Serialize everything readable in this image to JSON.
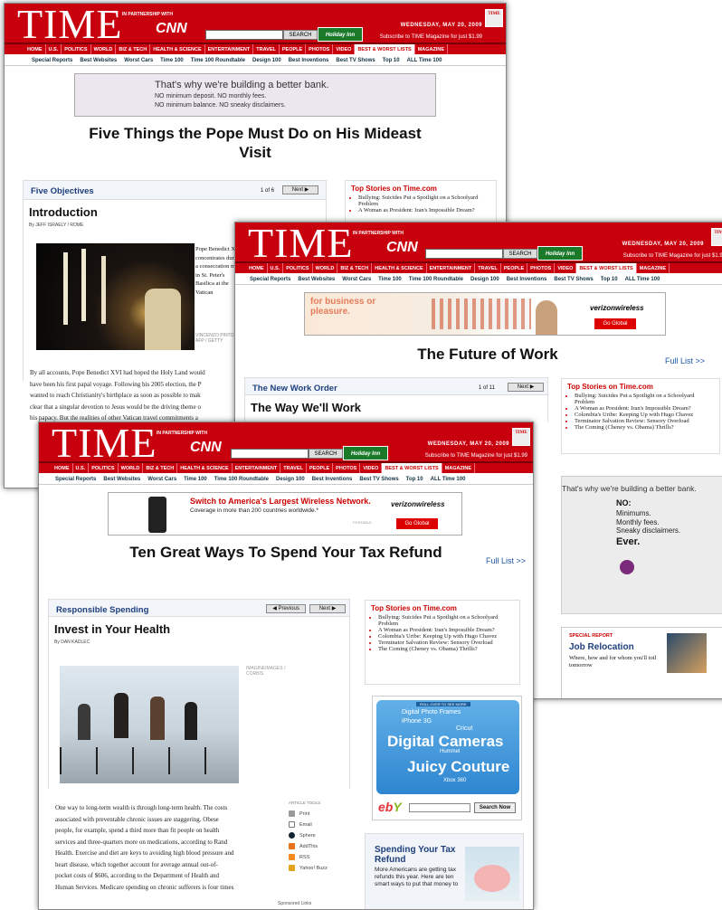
{
  "shared": {
    "logo": "TIME",
    "partnership": "IN PARTNERSHIP WITH",
    "cnn": "CNN",
    "search_button": "SEARCH",
    "holiday_inn": "Holiday Inn",
    "date": "WEDNESDAY, MAY 20, 2009",
    "subscribe": "Subscribe to TIME Magazine for just $1.99",
    "cover": "TIME",
    "nav": [
      "HOME",
      "U.S.",
      "POLITICS",
      "WORLD",
      "BIZ & TECH",
      "HEALTH & SCIENCE",
      "ENTERTAINMENT",
      "TRAVEL",
      "PEOPLE",
      "PHOTOS",
      "VIDEO",
      "BEST & WORST LISTS",
      "MAGAZINE"
    ],
    "subnav": [
      "Special Reports",
      "Best Websites",
      "Worst Cars",
      "Time 100",
      "Time 100 Roundtable",
      "Design 100",
      "Best Inventions",
      "Best TV Shows",
      "Top 10",
      "ALL Time 100"
    ],
    "next": "Next ▶",
    "previous": "◀ Previous",
    "full_list": "Full List >>",
    "top_stories_title": "Top Stories on Time.com",
    "top_stories": [
      "Bullying: Suicides Put a Spotlight on a Schoolyard Problem",
      "A Woman as President: Iran's Impossible Dream?",
      "Colombia's Uribe: Keeping Up with Hugo Chavez",
      "Terminator Salvation Review: Sensory Overload",
      "The Coming (Cheney vs. Obama) Thrills?"
    ]
  },
  "w1": {
    "ad_line1": "That's why we're building a better bank.",
    "ad_line2": "NO minimum deposit.   NO monthly fees.",
    "ad_line3": "NO minimum balance.   NO sneaky disclaimers.",
    "headline": "Five Things the Pope Must Do on His Mideast Visit",
    "section": "Five Objectives",
    "page": "1 of 6",
    "title": "Introduction",
    "byline": "By JEFF ISRAELY / ROME",
    "caption": "Pope Benedict XVI concentrates during a consecration mass in St. Peter's Basilica at the Vatican",
    "credit": "VINCENZO PINTO / AFP / GETTY",
    "body": [
      "By all accounts, Pope Benedict XVI had hoped the Holy Land would",
      "have been his first papal voyage. Following his 2005 election, the P",
      "wanted to reach Christianity's birthplace as soon as possible to mak",
      "clear that a singular devotion to Jesus would be the driving theme o",
      "his papacy. But the realities of other Vatican travel commitments a"
    ]
  },
  "w2": {
    "ad_text": "for business or pleasure.",
    "verizon": "verizonwireless",
    "go_global": "Go Global",
    "headline": "The Future of Work",
    "section": "The New Work Order",
    "page": "1 of 11",
    "title": "The Way We'll Work",
    "bank_line1": "That's why we're building a better bank.",
    "bank_no": "NO:",
    "bank_items": [
      "Minimums.",
      "Monthly fees.",
      "Sneaky disclaimers."
    ],
    "bank_ever": "Ever.",
    "special_label": "SPECIAL REPORT",
    "special_title": "Job Relocation",
    "special_desc": "Where, how and for whom you'll toil tomorrow"
  },
  "w3": {
    "ad_title": "Switch to America's Largest Wireless Network.",
    "ad_sub": "Coverage in more than 200 countries worldwide.*",
    "ad_postal": "POSTABLE",
    "verizon": "verizonwireless",
    "go_global": "Go Global",
    "headline": "Ten Great Ways To Spend Your Tax Refund",
    "section": "Responsible Spending",
    "title": "Invest in Your Health",
    "byline": "By DAN KADLEC",
    "credit": "IMAGINEIMAGES / CORBIS",
    "body": [
      "One way to long-term wealth is through long-term health. The costs",
      "associated with preventable chronic issues are staggering. Obese",
      "people, for example, spend a third more than fit people on health",
      "services and three-quarters more on medications, according to Rand",
      "Health. Exercise and diet are keys to avoiding high blood pressure and",
      "heart disease, which together account for average annual out-of-",
      "pocket costs of $606, according to the Department of Health and",
      "Human Services. Medicare spending on chronic sufferers is four times"
    ],
    "tools_title": "ARTICLE TOOLS",
    "tools": [
      "Print",
      "Email",
      "Sphere",
      "AddThis",
      "RSS",
      "Yahoo! Buzz"
    ],
    "sponsored": "Sponsored Links",
    "ebay_roll": "ROLL OVER TO SEE MORE",
    "ebay_items": [
      "Digital Photo Frames",
      "iPhone 3G",
      "Cricut"
    ],
    "ebay_big1": "Digital Cameras",
    "ebay_small": "Hummel",
    "ebay_big2": "Juicy Couture",
    "ebay_small2": "Xbox 360",
    "ebay_search": "Search Now",
    "promo_title": "Spending Your Tax Refund",
    "promo_desc": "More Americans are getting tax refunds this year. Here are ten smart ways to put that money to"
  },
  "colors": {
    "time_red": "#c8000e",
    "link_blue": "#1d57a8",
    "section_blue": "#1e3f7e"
  }
}
